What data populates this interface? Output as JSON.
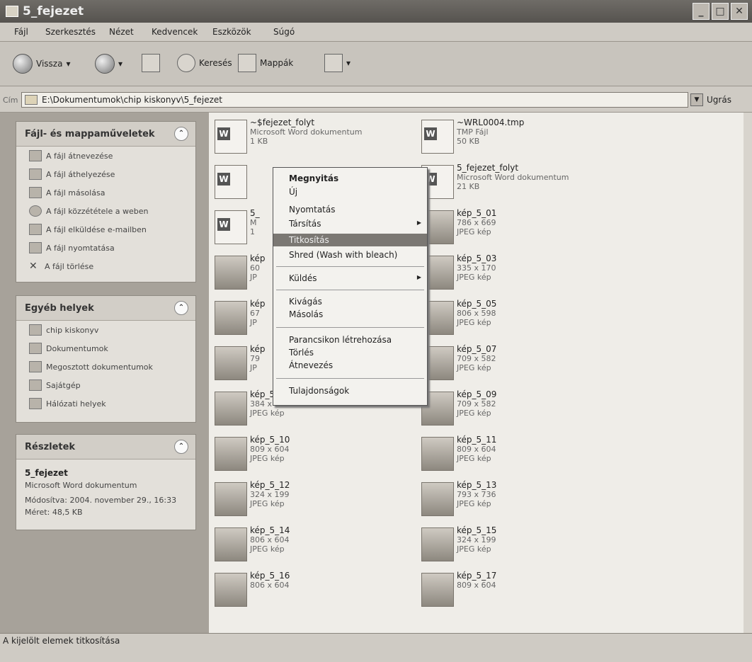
{
  "window": {
    "title": "5_fejezet",
    "controls": [
      "_",
      "□",
      "✕"
    ]
  },
  "menubar": [
    "Fájl",
    "Szerkesztés",
    "Nézet",
    "Kedvencek",
    "Eszközök",
    "Súgó"
  ],
  "toolbar": {
    "back": "Vissza",
    "search": "Keresés",
    "folders": "Mappák"
  },
  "address": {
    "label": "Cím",
    "path": "E:\\Dokumentumok\\chip kiskonyv\\5_fejezet",
    "go": "Ugrás"
  },
  "panels": {
    "file_tasks": {
      "title": "Fájl- és mappaműveletek",
      "items": [
        "A fájl átnevezése",
        "A fájl áthelyezése",
        "A fájl másolása",
        "A fájl közzététele a weben",
        "A fájl elküldése e-mailben",
        "A fájl nyomtatása",
        "A fájl törlése"
      ]
    },
    "other_places": {
      "title": "Egyéb helyek",
      "items": [
        "chip kiskonyv",
        "Dokumentumok",
        "Megosztott dokumentumok",
        "Sajátgép",
        "Hálózati helyek"
      ]
    },
    "details": {
      "title": "Részletek",
      "name": "5_fejezet",
      "type": "Microsoft Word dokumentum",
      "modified": "Módosítva: 2004. november 29., 16:33",
      "size": "Méret: 48,5 KB"
    }
  },
  "files_left": [
    {
      "name": "~$fejezet_folyt",
      "l2": "Microsoft Word dokumentum",
      "l3": "1 KB",
      "kind": "doc"
    },
    {
      "name": "",
      "l2": "",
      "l3": "",
      "kind": "doc"
    },
    {
      "name": "5_",
      "l2": "M",
      "l3": "1",
      "kind": "doc"
    },
    {
      "name": "kép",
      "l2": "60",
      "l3": "JP",
      "kind": "img"
    },
    {
      "name": "kép",
      "l2": "67",
      "l3": "JP",
      "kind": "img"
    },
    {
      "name": "kép",
      "l2": "79",
      "l3": "JP",
      "kind": "img"
    },
    {
      "name": "kép_5_08",
      "l2": "384 x 169",
      "l3": "JPEG kép",
      "kind": "img"
    },
    {
      "name": "kép_5_10",
      "l2": "809 x 604",
      "l3": "JPEG kép",
      "kind": "img"
    },
    {
      "name": "kép_5_12",
      "l2": "324 x 199",
      "l3": "JPEG kép",
      "kind": "img"
    },
    {
      "name": "kép_5_14",
      "l2": "806 x 604",
      "l3": "JPEG kép",
      "kind": "img"
    },
    {
      "name": "kép_5_16",
      "l2": "806 x 604",
      "l3": "",
      "kind": "img"
    }
  ],
  "files_right": [
    {
      "name": "~WRL0004.tmp",
      "l2": "TMP Fájl",
      "l3": "50 KB",
      "kind": "doc"
    },
    {
      "name": "5_fejezet_folyt",
      "l2": "Microsoft Word dokumentum",
      "l3": "21 KB",
      "kind": "doc"
    },
    {
      "name": "kép_5_01",
      "l2": "786 x 669",
      "l3": "JPEG kép",
      "kind": "img"
    },
    {
      "name": "kép_5_03",
      "l2": "335 x 170",
      "l3": "JPEG kép",
      "kind": "img"
    },
    {
      "name": "kép_5_05",
      "l2": "806 x 598",
      "l3": "JPEG kép",
      "kind": "img"
    },
    {
      "name": "kép_5_07",
      "l2": "709 x 582",
      "l3": "JPEG kép",
      "kind": "img"
    },
    {
      "name": "kép_5_09",
      "l2": "709 x 582",
      "l3": "JPEG kép",
      "kind": "img"
    },
    {
      "name": "kép_5_11",
      "l2": "809 x 604",
      "l3": "JPEG kép",
      "kind": "img"
    },
    {
      "name": "kép_5_13",
      "l2": "793 x 736",
      "l3": "JPEG kép",
      "kind": "img"
    },
    {
      "name": "kép_5_15",
      "l2": "324 x 199",
      "l3": "JPEG kép",
      "kind": "img"
    },
    {
      "name": "kép_5_17",
      "l2": "809 x 604",
      "l3": "",
      "kind": "img"
    }
  ],
  "context_menu": {
    "open": "Megnyitás",
    "new": "Új",
    "print": "Nyomtatás",
    "open_with": "Társítás",
    "encrypt": "Titkosítás",
    "shred": "Shred (Wash with bleach)",
    "send_to": "Küldés",
    "cut": "Kivágás",
    "copy": "Másolás",
    "create_shortcut": "Parancsikon létrehozása",
    "delete": "Törlés",
    "rename": "Átnevezés",
    "properties": "Tulajdonságok"
  },
  "status": "A kijelölt elemek titkosítása"
}
